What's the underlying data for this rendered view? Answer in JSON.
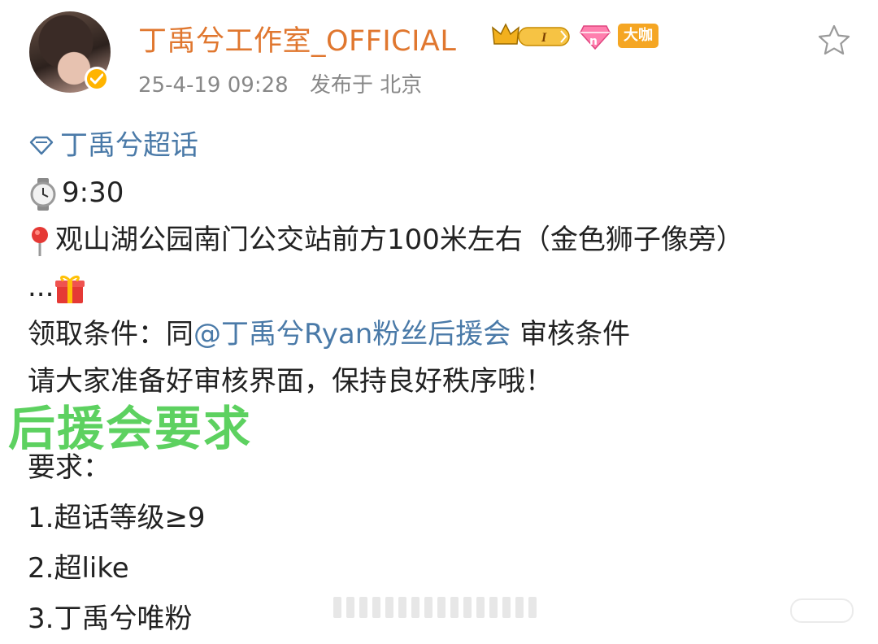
{
  "post": {
    "username": "丁禹兮工作室_OFFICIAL",
    "vip_badge": "大咖",
    "timestamp": "25-4-19 09:28",
    "location": "发布于 北京",
    "icons": {
      "favorite": "star-outline-icon",
      "verified": "verified-check-icon",
      "topic": "super-topic-diamond-icon"
    }
  },
  "body": {
    "topic": "丁禹兮超话",
    "time": "9:30",
    "place": "观山湖公园南门公交站前方100米左右（金色狮子像旁）",
    "gift_prefix": "...",
    "condition_prefix": "领取条件：同",
    "condition_mention": "@丁禹兮Ryan粉丝后援会",
    "condition_suffix": " 审核条件",
    "notice": "请大家准备好审核界面，保持良好秩序哦！"
  },
  "overlay": {
    "heading": "后援会要求"
  },
  "requirements": {
    "title": "要求：",
    "items": [
      "1.超话等级≥9",
      "2.超like",
      "3.丁禹兮唯粉"
    ]
  },
  "colors": {
    "username": "#e0772f",
    "link": "#4a7aa8",
    "overlay_green": "#5dd160",
    "meta_gray": "#888888"
  }
}
